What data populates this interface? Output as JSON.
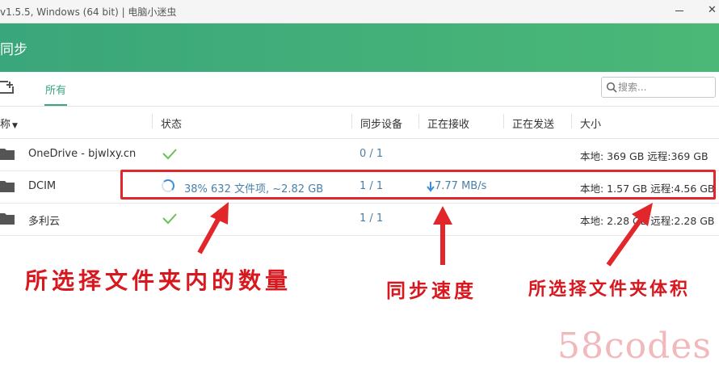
{
  "window": {
    "title": "v1.5.5, Windows (64 bit) | 电脑小迷虫"
  },
  "header": {
    "title": "同步"
  },
  "toolbar": {
    "tab_all": "所有",
    "search_placeholder": "搜索..."
  },
  "table": {
    "columns": {
      "name": "称",
      "status": "状态",
      "devices": "同步设备",
      "receiving": "正在接收",
      "sending": "正在发送",
      "size": "大小"
    },
    "rows": [
      {
        "name": "OneDrive - bjwlxy.cn",
        "status_icon": "check-icon",
        "devices": "0 / 1",
        "receiving": "",
        "sending": "",
        "size": "本地: 369 GB 远程:369 GB"
      },
      {
        "name": "DCIM",
        "status_icon": "syncing-spinner-icon",
        "status_text": "38% 632 文件项, ~2.82 GB",
        "devices": "1 / 1",
        "receiving": "7.77 MB/s",
        "sending": "",
        "size": "本地: 1.57 GB 远程:4.56 GB"
      },
      {
        "name": "多利云",
        "status_icon": "check-icon",
        "devices": "1 / 1",
        "receiving": "",
        "sending": "",
        "size": "本地: 2.28 GB 远程:2.28 GB"
      }
    ]
  },
  "annotations": {
    "file_count": "所选择文件夹内的数量",
    "sync_speed": "同步速度",
    "folder_size": "所选择文件夹体积"
  },
  "watermark": "58codes",
  "colors": {
    "accent_green": "#3aa67b",
    "link_blue": "#4a7fa8",
    "annotation_red": "#d7181f"
  }
}
